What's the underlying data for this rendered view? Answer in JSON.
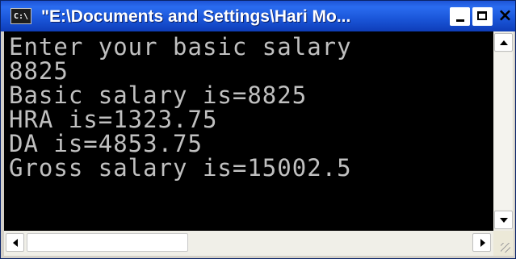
{
  "window": {
    "title": "\"E:\\Documents and Settings\\Hari Mo...",
    "system_icon_text": "C:\\",
    "title_bar_color": "#1d54d6",
    "controls": {
      "minimize": "minimize",
      "maximize": "maximize",
      "close_glyph": "×"
    }
  },
  "console": {
    "background": "#000000",
    "foreground": "#c0c0c0",
    "lines": [
      "Enter your basic salary",
      "8825",
      "Basic salary is=8825",
      "HRA is=1323.75",
      "DA is=4853.75",
      "Gross salary is=15002.5"
    ]
  },
  "scrollbars": {
    "vertical": {
      "up_icon": "arrow-up-icon",
      "down_icon": "arrow-down-icon"
    },
    "horizontal": {
      "left_icon": "arrow-left-icon",
      "right_icon": "arrow-right-icon"
    }
  }
}
